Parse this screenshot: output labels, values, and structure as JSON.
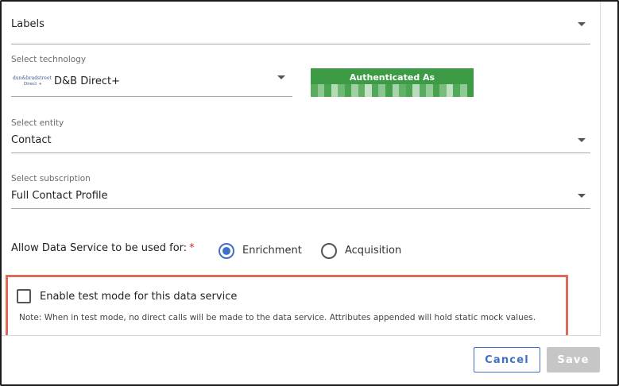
{
  "form": {
    "labels_field": {
      "value": "Labels"
    },
    "technology": {
      "caption": "Select technology",
      "value": "D&B Direct+",
      "logo_text_top": "dun&bradstreet",
      "logo_text_bottom": "Direct +"
    },
    "auth": {
      "title": "Authenticated As"
    },
    "entity": {
      "caption": "Select entity",
      "value": "Contact"
    },
    "subscription": {
      "caption": "Select subscription",
      "value": "Full Contact Profile"
    },
    "usage": {
      "label": "Allow Data Service to be used for:",
      "required_mark": "*",
      "options": [
        {
          "label": "Enrichment",
          "selected": true
        },
        {
          "label": "Acquisition",
          "selected": false
        }
      ]
    },
    "test_mode": {
      "label": "Enable test mode for this data service",
      "checked": false,
      "note": "Note: When in test mode, no direct calls will be made to the data service. Attributes appended will hold static mock values."
    }
  },
  "footer": {
    "cancel_label": "Cancel",
    "save_label": "Save"
  },
  "colors": {
    "accent": "#3f6fc6",
    "auth_green": "#3e9b45",
    "highlight_border": "#e06a5a",
    "required": "#d12c2c",
    "disabled_button": "#c6c6c6"
  }
}
